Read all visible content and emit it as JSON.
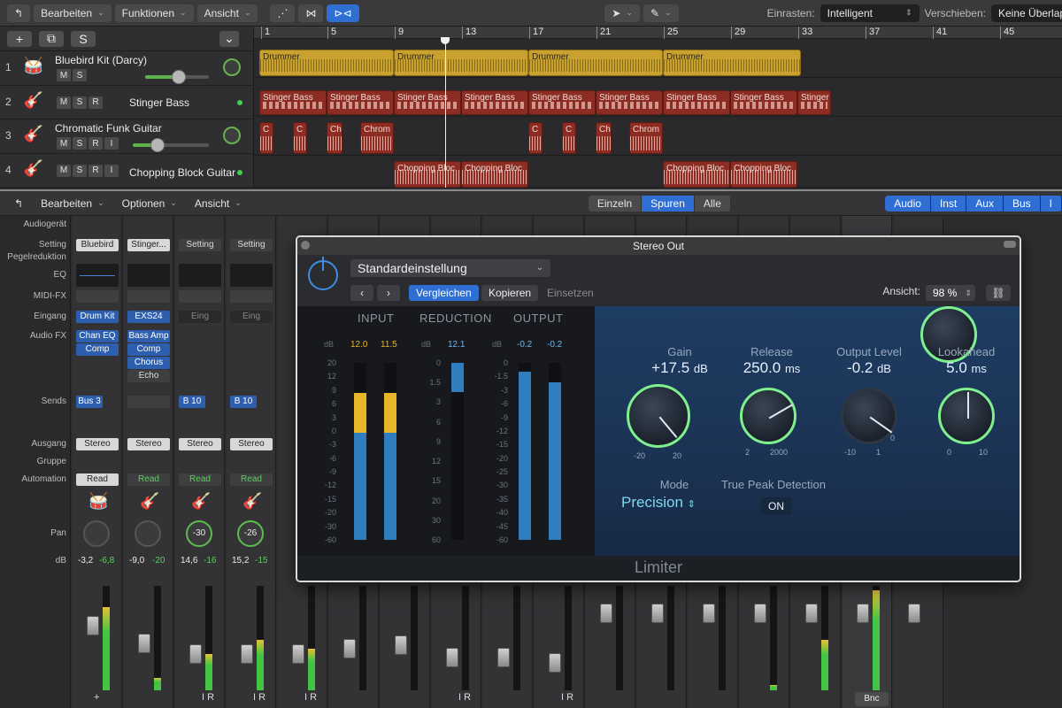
{
  "toolbar": {
    "back_glyph": "↰",
    "edit": "Bearbeiten",
    "functions": "Funktionen",
    "view": "Ansicht",
    "tool_pointer": "pointer-tool-icon",
    "tool_pencil": "pencil-tool-icon",
    "snap_label": "Einrasten:",
    "snap_value": "Intelligent",
    "move_label": "Verschieben:",
    "move_value": "Keine Überlap"
  },
  "track_header_buttons": {
    "add": "+",
    "duplicate": "⧉",
    "s": "S"
  },
  "ruler": [
    "1",
    "5",
    "9",
    "13",
    "17",
    "21",
    "25",
    "29",
    "33",
    "37",
    "41",
    "45"
  ],
  "tracks": [
    {
      "num": "1",
      "name": "Bluebird Kit (Darcy)",
      "buttons": [
        "M",
        "S"
      ],
      "icon": "drum-kit-icon"
    },
    {
      "num": "2",
      "name": "Stinger Bass",
      "buttons": [
        "M",
        "S",
        "R"
      ],
      "icon": "bass-guitar-icon"
    },
    {
      "num": "3",
      "name": "Chromatic Funk Guitar",
      "buttons": [
        "M",
        "S",
        "R",
        "I"
      ],
      "icon": "electric-guitar-icon"
    },
    {
      "num": "4",
      "name": "Chopping Block Guitar",
      "buttons": [
        "M",
        "S",
        "R",
        "I"
      ],
      "icon": "electric-guitar-icon"
    }
  ],
  "regions": {
    "drum": "Drummer",
    "bass": "Stinger Bass",
    "bass_short": "Stinger",
    "funk": [
      "C",
      "C",
      "Ch",
      "Chrom"
    ],
    "chop": "Chopping Bloc"
  },
  "mixer_toolbar": {
    "edit": "Bearbeiten",
    "options": "Optionen",
    "view": "Ansicht",
    "modes": [
      "Einzeln",
      "Spuren",
      "Alle"
    ],
    "active_mode": "Spuren",
    "filters": [
      "Audio",
      "Inst",
      "Aux",
      "Bus",
      "I"
    ]
  },
  "mixer_rows": [
    "Audiogerät",
    "Setting",
    "Pegelreduktion",
    "EQ",
    "MIDI-FX",
    "Eingang",
    "Audio FX",
    "Sends",
    "Ausgang",
    "Gruppe",
    "Automation",
    "Pan",
    "dB"
  ],
  "strips": [
    {
      "setting": "Bluebird",
      "input": "Drum Kit",
      "fx": [
        "Chan EQ",
        "Comp"
      ],
      "send": "Bus 3",
      "output": "Stereo",
      "automation": "Read",
      "pan": "",
      "db1": "-3,2",
      "db2": "-6,8"
    },
    {
      "setting": "Stinger...",
      "input": "EXS24",
      "fx": [
        "Bass Amp",
        "Comp",
        "Chorus",
        "Echo"
      ],
      "send": "",
      "output": "Stereo",
      "automation": "Read",
      "pan": "",
      "db1": "-9,0",
      "db2": "-20"
    },
    {
      "setting": "Setting",
      "input": "Eing",
      "fx": [],
      "send": "B 10",
      "output": "Stereo",
      "automation": "Read",
      "pan": "-30",
      "db1": "14,6",
      "db2": "-16"
    },
    {
      "setting": "Setting",
      "input": "Eing",
      "fx": [],
      "send": "B 10",
      "output": "Stereo",
      "automation": "Read",
      "pan": "-26",
      "db1": "15,2",
      "db2": "-15"
    }
  ],
  "strip_bottom": {
    "add": "+",
    "ir": "I R",
    "bnc": "Bnc"
  },
  "plugin": {
    "window_title": "Stereo Out",
    "preset": "Standardeinstellung",
    "compare": "Vergleichen",
    "copy": "Kopieren",
    "paste": "Einsetzen",
    "view_label": "Ansicht:",
    "zoom": "98 %",
    "footer": "Limiter",
    "meters": {
      "input": {
        "label": "INPUT",
        "values": [
          "12.0",
          "11.5"
        ]
      },
      "reduction": {
        "label": "REDUCTION",
        "values": [
          "12.1"
        ]
      },
      "output": {
        "label": "OUTPUT",
        "values": [
          "-0.2",
          "-0.2"
        ]
      },
      "db": "dB",
      "input_scale": [
        "20",
        "12",
        "9",
        "6",
        "3",
        "0",
        "-3",
        "-6",
        "-9",
        "-12",
        "-15",
        "-20",
        "-30",
        "-60"
      ],
      "reduction_scale": [
        "0",
        "1.5",
        "3",
        "6",
        "9",
        "12",
        "15",
        "20",
        "30",
        "60"
      ],
      "output_scale": [
        "0",
        "-1.5",
        "-3",
        "-6",
        "-9",
        "-12",
        "-15",
        "-20",
        "-25",
        "-30",
        "-35",
        "-40",
        "-45",
        "-60"
      ]
    },
    "controls": {
      "gain": {
        "label": "Gain",
        "value": "+17.5",
        "unit": "dB",
        "min": "-20",
        "max": "20"
      },
      "release": {
        "label": "Release",
        "value": "250.0",
        "unit": "ms",
        "min": "2",
        "max": "2000"
      },
      "output": {
        "label": "Output Level",
        "value": "-0.2",
        "unit": "dB",
        "min": "-10",
        "max": "1",
        "mid": "0"
      },
      "lookahead": {
        "label": "Lookahead",
        "value": "5.0",
        "unit": "ms",
        "min": "0",
        "max": "10"
      },
      "mode_label": "Mode",
      "mode_value": "Precision",
      "tpd_label": "True Peak Detection",
      "tpd_value": "ON"
    }
  }
}
